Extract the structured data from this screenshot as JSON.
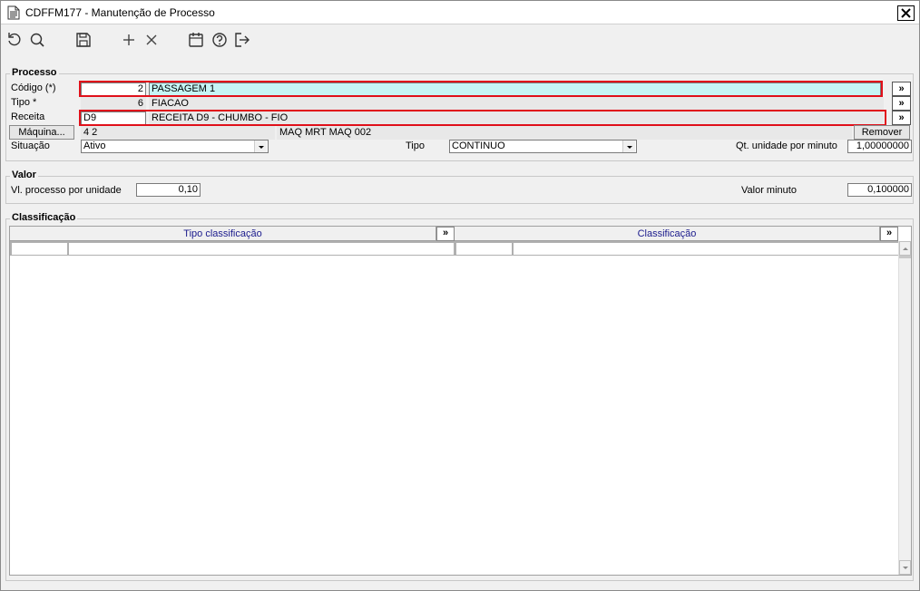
{
  "window": {
    "title": "CDFFM177 - Manutenção de Processo"
  },
  "toolbar": {
    "buttons": [
      "refresh-icon",
      "search-icon",
      "save-icon",
      "add-icon",
      "delete-icon",
      "calendar-icon",
      "help-icon",
      "exit-icon"
    ]
  },
  "processo": {
    "group_title": "Processo",
    "codigo_label": "Código (*)",
    "codigo_value": "2",
    "codigo_desc": "PASSAGEM 1",
    "tipo_label": "Tipo *",
    "tipo_value": "6",
    "tipo_desc": "FIACAO",
    "receita_label": "Receita",
    "receita_value": "D9",
    "receita_desc": "RECEITA D9 - CHUMBO - FIO",
    "maquina_button": "Máquina...",
    "maquina_value": "4 2",
    "maquina_desc": "MAQ MRT MAQ 002",
    "remover_button": "Remover",
    "situacao_label": "Situação",
    "situacao_value": "Ativo",
    "tipo2_label": "Tipo",
    "tipo2_value": "CONTINUO",
    "qt_label": "Qt. unidade por minuto",
    "qt_value": "1,00000000",
    "lookup_label": "»"
  },
  "valor": {
    "group_title": "Valor",
    "vl_processo_label": "Vl. processo por unidade",
    "vl_processo_value": "0,10",
    "valor_minuto_label": "Valor minuto",
    "valor_minuto_value": "0,100000"
  },
  "classificacao": {
    "group_title": "Classificação",
    "columns": [
      "Tipo classificação",
      "Classificação"
    ],
    "lookup_label": "»"
  },
  "colors": {
    "highlight_border": "#e0101a",
    "cyan_field": "#c6f5f5",
    "header_text": "#1a1a8c"
  }
}
